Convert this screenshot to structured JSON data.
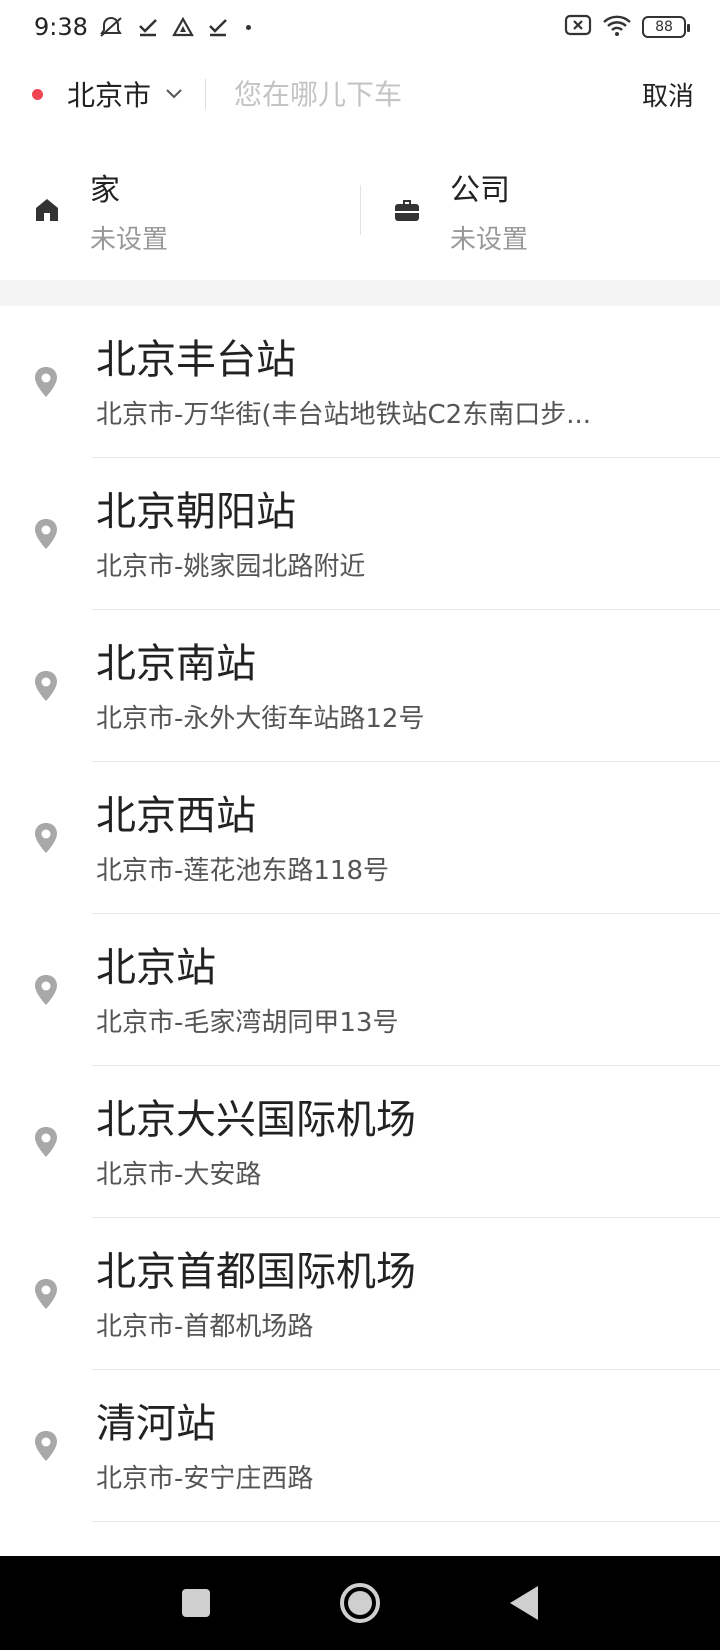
{
  "status_bar": {
    "time": "9:38",
    "battery": "88"
  },
  "header": {
    "city": "北京市",
    "search_placeholder": "您在哪儿下车",
    "cancel_label": "取消",
    "accent_color": "#f04452"
  },
  "shortcuts": {
    "home": {
      "title": "家",
      "subtitle": "未设置",
      "icon": "home-icon"
    },
    "work": {
      "title": "公司",
      "subtitle": "未设置",
      "icon": "briefcase-icon"
    }
  },
  "places": [
    {
      "name": "北京丰台站",
      "address": "北京市-万华街(丰台站地铁站C2东南口步..."
    },
    {
      "name": "北京朝阳站",
      "address": "北京市-姚家园北路附近"
    },
    {
      "name": "北京南站",
      "address": "北京市-永外大街车站路12号"
    },
    {
      "name": "北京西站",
      "address": "北京市-莲花池东路118号"
    },
    {
      "name": "北京站",
      "address": "北京市-毛家湾胡同甲13号"
    },
    {
      "name": "北京大兴国际机场",
      "address": "北京市-大安路"
    },
    {
      "name": "北京首都国际机场",
      "address": "北京市-首都机场路"
    },
    {
      "name": "清河站",
      "address": "北京市-安宁庄西路"
    }
  ]
}
